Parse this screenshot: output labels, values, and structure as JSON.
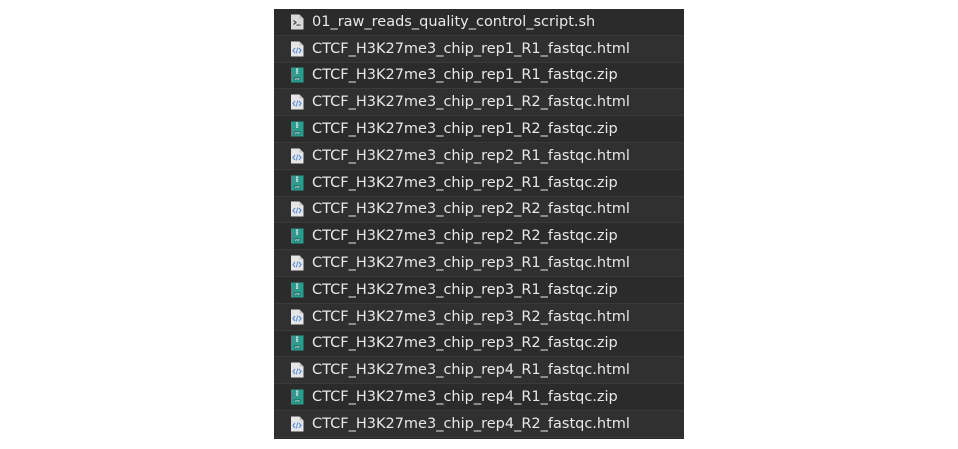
{
  "file_list": {
    "items": [
      {
        "name": "01_raw_reads_quality_control_script.sh",
        "type": "script",
        "icon": "shell-script-file-icon"
      },
      {
        "name": "CTCF_H3K27me3_chip_rep1_R1_fastqc.html",
        "type": "html",
        "icon": "html-file-icon"
      },
      {
        "name": "CTCF_H3K27me3_chip_rep1_R1_fastqc.zip",
        "type": "zip",
        "icon": "zip-file-icon"
      },
      {
        "name": "CTCF_H3K27me3_chip_rep1_R2_fastqc.html",
        "type": "html",
        "icon": "html-file-icon"
      },
      {
        "name": "CTCF_H3K27me3_chip_rep1_R2_fastqc.zip",
        "type": "zip",
        "icon": "zip-file-icon"
      },
      {
        "name": "CTCF_H3K27me3_chip_rep2_R1_fastqc.html",
        "type": "html",
        "icon": "html-file-icon"
      },
      {
        "name": "CTCF_H3K27me3_chip_rep2_R1_fastqc.zip",
        "type": "zip",
        "icon": "zip-file-icon"
      },
      {
        "name": "CTCF_H3K27me3_chip_rep2_R2_fastqc.html",
        "type": "html",
        "icon": "html-file-icon"
      },
      {
        "name": "CTCF_H3K27me3_chip_rep2_R2_fastqc.zip",
        "type": "zip",
        "icon": "zip-file-icon"
      },
      {
        "name": "CTCF_H3K27me3_chip_rep3_R1_fastqc.html",
        "type": "html",
        "icon": "html-file-icon"
      },
      {
        "name": "CTCF_H3K27me3_chip_rep3_R1_fastqc.zip",
        "type": "zip",
        "icon": "zip-file-icon"
      },
      {
        "name": "CTCF_H3K27me3_chip_rep3_R2_fastqc.html",
        "type": "html",
        "icon": "html-file-icon"
      },
      {
        "name": "CTCF_H3K27me3_chip_rep3_R2_fastqc.zip",
        "type": "zip",
        "icon": "zip-file-icon"
      },
      {
        "name": "CTCF_H3K27me3_chip_rep4_R1_fastqc.html",
        "type": "html",
        "icon": "html-file-icon"
      },
      {
        "name": "CTCF_H3K27me3_chip_rep4_R1_fastqc.zip",
        "type": "zip",
        "icon": "zip-file-icon"
      },
      {
        "name": "CTCF_H3K27me3_chip_rep4_R2_fastqc.html",
        "type": "html",
        "icon": "html-file-icon"
      }
    ]
  },
  "colors": {
    "panel_background": "#2b2b2b",
    "text": "#e8e8e8",
    "zip_icon": "#2a9d8f",
    "html_icon_accent": "#5b8fd6"
  }
}
